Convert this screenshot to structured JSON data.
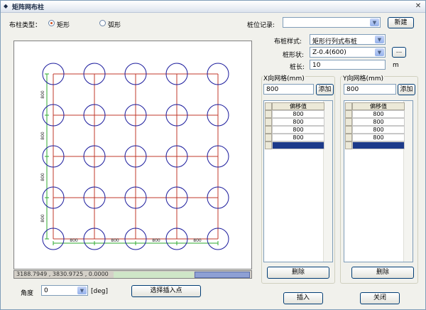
{
  "window": {
    "title": "矩阵网布柱"
  },
  "layout_type": {
    "label": "布柱类型：",
    "options": [
      {
        "label": "矩形",
        "selected": true
      },
      {
        "label": "弧形",
        "selected": false
      }
    ]
  },
  "pile_record": {
    "label": "桩位记录:",
    "value": "",
    "new_label": "新建"
  },
  "style": {
    "label": "布桩样式:",
    "value": "矩形行列式布桩"
  },
  "shape": {
    "label": "桩形状:",
    "value": "Z-0.4(600)",
    "more_label": "..."
  },
  "length": {
    "label": "桩长:",
    "value": "10",
    "unit": "m"
  },
  "x_grid": {
    "title": "X向网格(mm)",
    "input_value": "800",
    "add_label": "添加",
    "column": "偏移值",
    "rows": [
      "800",
      "800",
      "800",
      "800",
      ""
    ],
    "delete_label": "删除"
  },
  "y_grid": {
    "title": "Y向网格(mm)",
    "input_value": "800",
    "add_label": "添加",
    "column": "偏移值",
    "rows": [
      "800",
      "800",
      "800",
      "800",
      ""
    ],
    "delete_label": "删除"
  },
  "canvas": {
    "dim_labels_bottom": [
      "800",
      "800",
      "800",
      "800"
    ],
    "dim_labels_left": [
      "800",
      "800",
      "800",
      "800"
    ]
  },
  "status": {
    "coords": "3188.7949 , 3830.9725 , 0.0000"
  },
  "angle": {
    "label": "角度",
    "value": "0",
    "unit": "[deg]"
  },
  "actions": {
    "select_point": "选择插入点",
    "insert": "插入",
    "close": "关闭"
  },
  "colors": {
    "grid_line": "#c0392b",
    "pile": "#1a1a9c",
    "dim": "#2eaa2e"
  }
}
